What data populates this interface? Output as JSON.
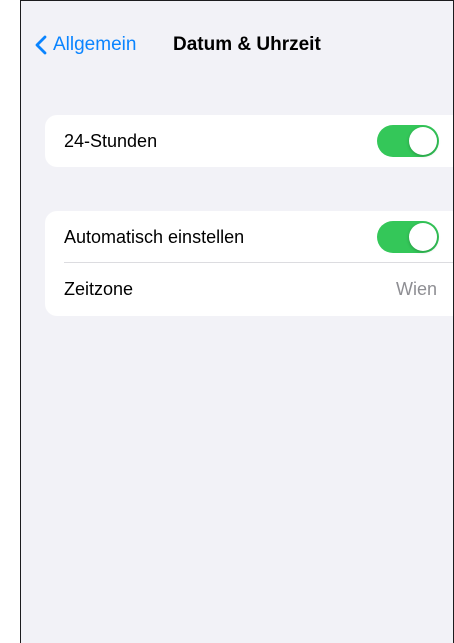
{
  "navbar": {
    "back_label": "Allgemein",
    "title": "Datum & Uhrzeit"
  },
  "groups": [
    {
      "rows": [
        {
          "label": "24-Stunden",
          "control": "toggle",
          "on": true
        }
      ]
    },
    {
      "rows": [
        {
          "label": "Automatisch einstellen",
          "control": "toggle",
          "on": true
        },
        {
          "label": "Zeitzone",
          "value": "Wien"
        }
      ]
    }
  ],
  "colors": {
    "accent": "#0a84ff",
    "toggle_on": "#34c759",
    "background": "#f2f2f7",
    "secondary_text": "#8e8e93"
  },
  "icons": {
    "back": "chevron-left-icon"
  }
}
